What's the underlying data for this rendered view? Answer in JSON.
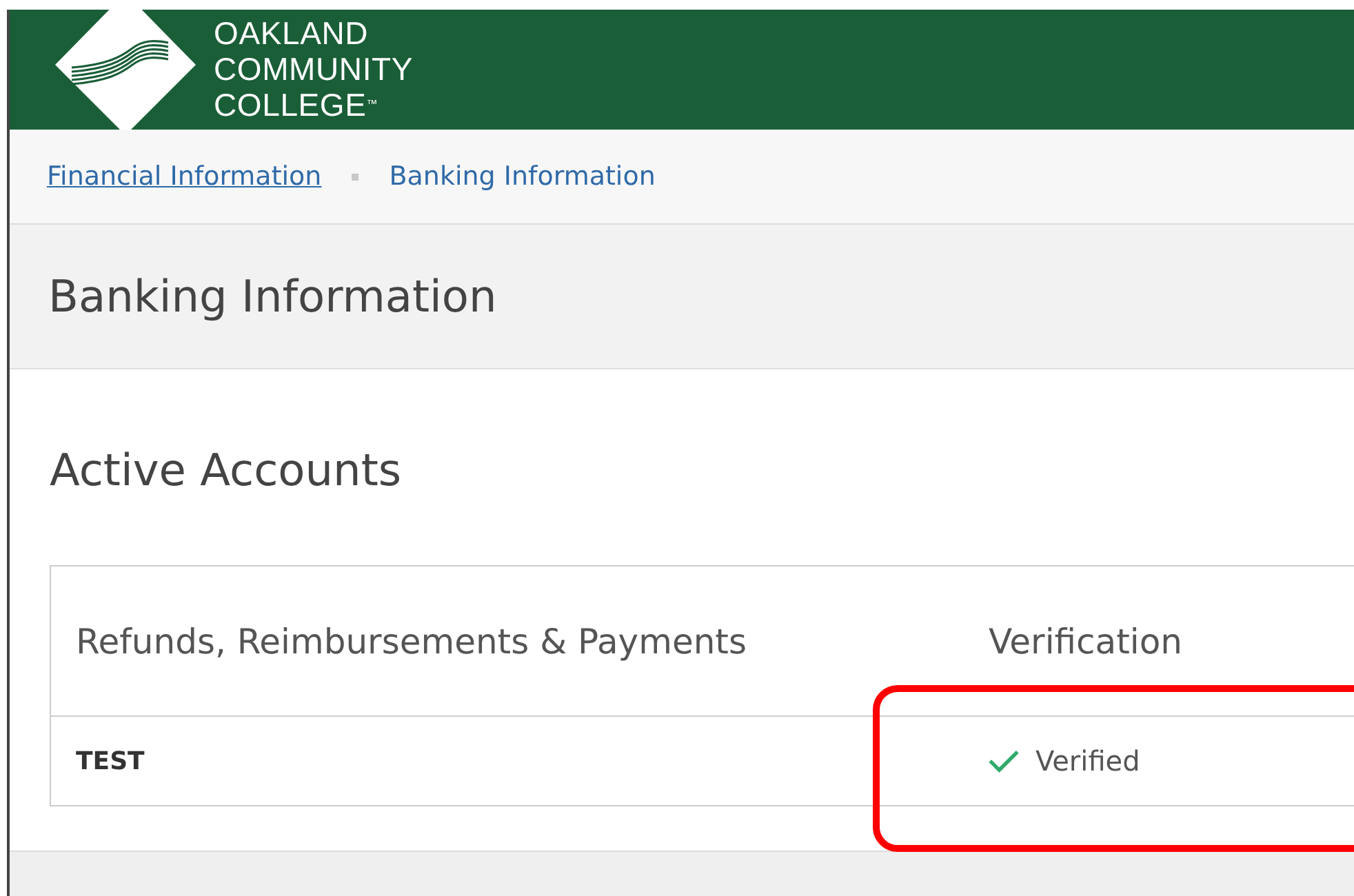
{
  "logo": {
    "lines": [
      "OAKLAND",
      "COMMUNITY",
      "COLLEGE$^{™}$"
    ]
  },
  "breadcrumb": [
    {
      "label": "Financial Information",
      "kind": "link"
    },
    {
      "label": "Banking Information",
      "kind": "current"
    }
  ],
  "page_title": "Banking Information",
  "section_title": "Active Accounts",
  "table": {
    "columns": [
      "Refunds, Reimbursements & Payments",
      "Verification"
    ],
    "rows": [
      {
        "name": "TEST",
        "verification": {
          "status": "Verified",
          "verified": true
        }
      }
    ]
  }
}
